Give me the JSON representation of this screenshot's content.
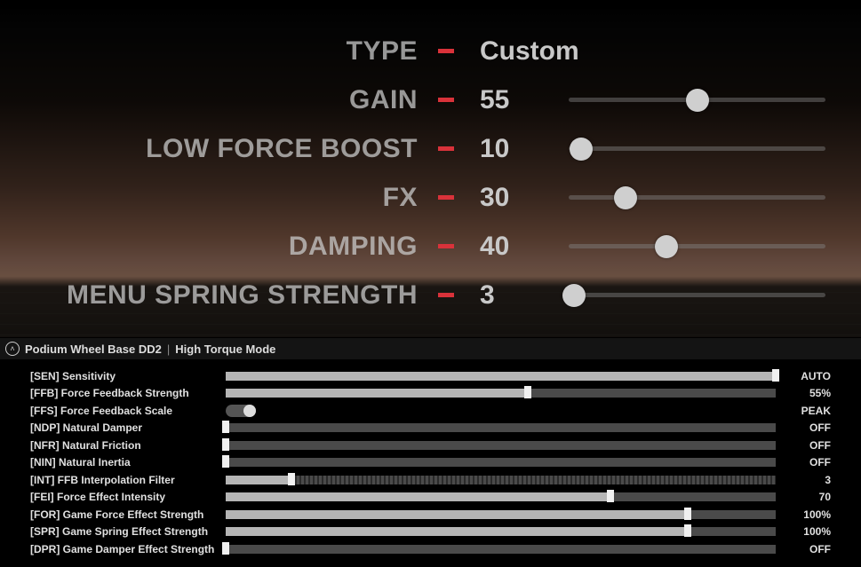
{
  "top_settings": {
    "rows": [
      {
        "label": "TYPE",
        "value": "Custom",
        "has_slider": false
      },
      {
        "label": "GAIN",
        "value": "55",
        "has_slider": true,
        "knob_pct": 50
      },
      {
        "label": "LOW FORCE BOOST",
        "value": "10",
        "has_slider": true,
        "knob_pct": 5
      },
      {
        "label": "FX",
        "value": "30",
        "has_slider": true,
        "knob_pct": 22
      },
      {
        "label": "DAMPING",
        "value": "40",
        "has_slider": true,
        "knob_pct": 38
      },
      {
        "label": "MENU SPRING STRENGTH",
        "value": "3",
        "has_slider": true,
        "knob_pct": 2
      }
    ]
  },
  "panel": {
    "collapse_glyph": "˄",
    "title": "Podium Wheel Base DD2",
    "mode": "High Torque Mode"
  },
  "params": [
    {
      "label": "[SEN] Sensitivity",
      "kind": "slider",
      "fill_pct": 100,
      "handle_pct": 100,
      "value": "AUTO"
    },
    {
      "label": "[FFB] Force Feedback Strength",
      "kind": "slider",
      "fill_pct": 55,
      "handle_pct": 55,
      "value": "55%"
    },
    {
      "label": "[FFS] Force Feedback Scale",
      "kind": "toggle",
      "toggle_on": true,
      "value": "PEAK"
    },
    {
      "label": "[NDP] Natural Damper",
      "kind": "slider",
      "fill_pct": 0,
      "handle_pct": 0,
      "value": "OFF"
    },
    {
      "label": "[NFR] Natural Friction",
      "kind": "slider",
      "fill_pct": 0,
      "handle_pct": 0,
      "value": "OFF"
    },
    {
      "label": "[NIN] Natural Inertia",
      "kind": "slider",
      "fill_pct": 0,
      "handle_pct": 0,
      "value": "OFF"
    },
    {
      "label": "[INT] FFB Interpolation Filter",
      "kind": "slider",
      "dashed": true,
      "fill_pct": 12,
      "handle_pct": 12,
      "value": "3"
    },
    {
      "label": "[FEI] Force Effect Intensity",
      "kind": "slider",
      "fill_pct": 70,
      "handle_pct": 70,
      "value": "70"
    },
    {
      "label": "[FOR] Game Force Effect Strength",
      "kind": "slider",
      "fill_pct": 84,
      "handle_pct": 84,
      "value": "100%"
    },
    {
      "label": "[SPR] Game Spring Effect Strength",
      "kind": "slider",
      "fill_pct": 84,
      "handle_pct": 84,
      "value": "100%"
    },
    {
      "label": "[DPR] Game Damper Effect Strength",
      "kind": "slider",
      "fill_pct": 0,
      "handle_pct": 0,
      "value": "OFF"
    }
  ]
}
